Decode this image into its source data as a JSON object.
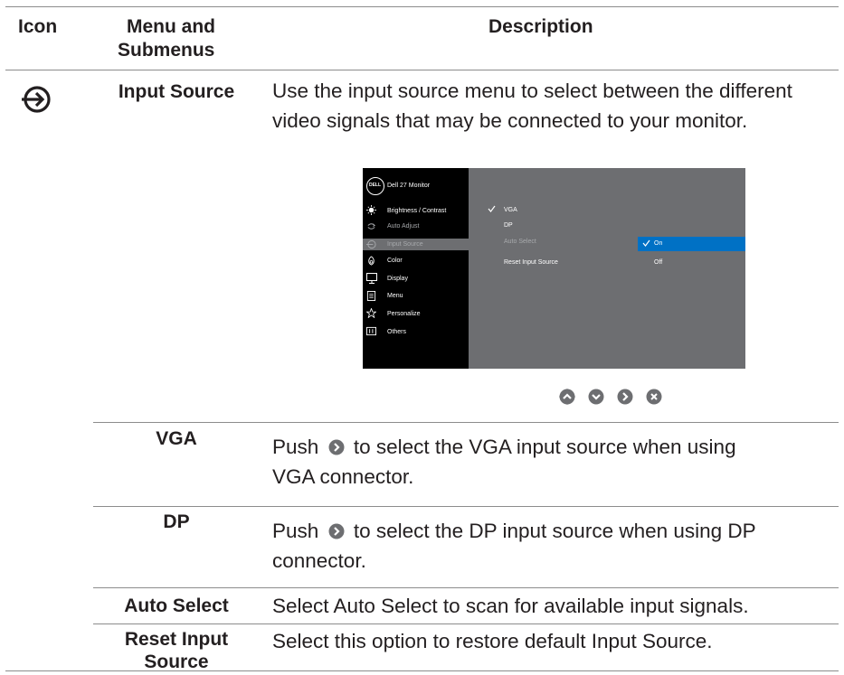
{
  "header": {
    "icon": "Icon",
    "menu_line1": "Menu and",
    "menu_line2": "Submenus",
    "description": "Description"
  },
  "input_source": {
    "icon": "input-source-icon",
    "label": "Input Source",
    "description": "Use the input source menu to select between the different video signals that may be connected to your monitor."
  },
  "osd": {
    "brand": "DELL",
    "title": "Dell 27 Monitor",
    "menu": [
      {
        "label": "Brightness / Contrast",
        "icon": "brightness-icon",
        "dim": false
      },
      {
        "label": "Auto Adjust",
        "icon": "auto-adjust-icon",
        "dim": true
      },
      {
        "label": "Input Source",
        "icon": "input-source-icon",
        "dim": true,
        "selected": true
      },
      {
        "label": "Color",
        "icon": "color-icon",
        "dim": false
      },
      {
        "label": "Display",
        "icon": "display-icon",
        "dim": false
      },
      {
        "label": "Menu",
        "icon": "menu-icon",
        "dim": false
      },
      {
        "label": "Personalize",
        "icon": "star-icon",
        "dim": false
      },
      {
        "label": "Others",
        "icon": "others-icon",
        "dim": false
      }
    ],
    "submenu": {
      "vga": "VGA",
      "dp": "DP",
      "auto_select": "Auto Select",
      "reset": "Reset Input Source"
    },
    "options": {
      "on": "On",
      "off": "Off"
    },
    "colors": {
      "selected": "#0071c5",
      "panel": "#6d6e71",
      "left": "#000000"
    }
  },
  "nav_buttons": [
    "up-icon",
    "down-icon",
    "right-icon",
    "exit-icon"
  ],
  "rows": [
    {
      "label": "VGA",
      "desc_before": "Push",
      "icon": "right-arrow-button-icon",
      "desc_after": "to select the VGA input source when using",
      "desc_line2": "VGA connector."
    },
    {
      "label": "DP",
      "desc_before": "Push",
      "icon": "right-arrow-button-icon",
      "desc_after": "to select the DP input source when using DP",
      "desc_line2": "connector."
    },
    {
      "label": "Auto Select",
      "description": "Select Auto Select to scan for available input signals."
    },
    {
      "label_line1": "Reset Input",
      "label_line2": "Source",
      "description": "Select this option to restore default Input Source."
    }
  ]
}
